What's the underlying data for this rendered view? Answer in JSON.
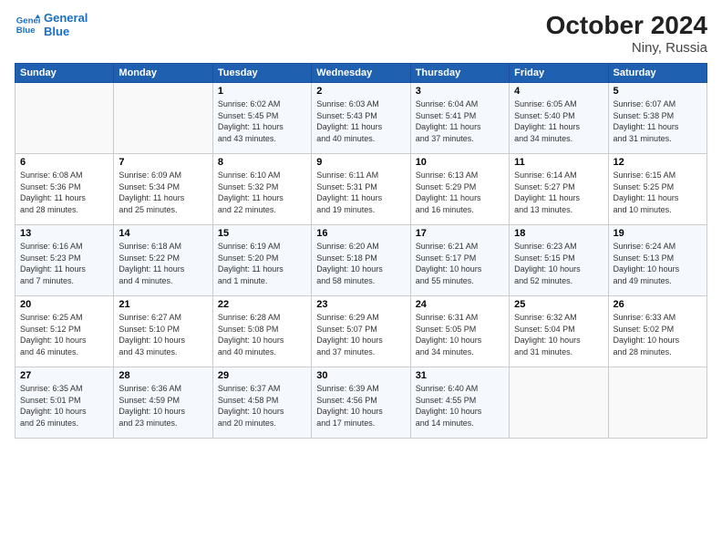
{
  "logo": {
    "line1": "General",
    "line2": "Blue"
  },
  "title": "October 2024",
  "subtitle": "Niny, Russia",
  "days_of_week": [
    "Sunday",
    "Monday",
    "Tuesday",
    "Wednesday",
    "Thursday",
    "Friday",
    "Saturday"
  ],
  "weeks": [
    [
      {
        "num": "",
        "info": ""
      },
      {
        "num": "",
        "info": ""
      },
      {
        "num": "1",
        "info": "Sunrise: 6:02 AM\nSunset: 5:45 PM\nDaylight: 11 hours\nand 43 minutes."
      },
      {
        "num": "2",
        "info": "Sunrise: 6:03 AM\nSunset: 5:43 PM\nDaylight: 11 hours\nand 40 minutes."
      },
      {
        "num": "3",
        "info": "Sunrise: 6:04 AM\nSunset: 5:41 PM\nDaylight: 11 hours\nand 37 minutes."
      },
      {
        "num": "4",
        "info": "Sunrise: 6:05 AM\nSunset: 5:40 PM\nDaylight: 11 hours\nand 34 minutes."
      },
      {
        "num": "5",
        "info": "Sunrise: 6:07 AM\nSunset: 5:38 PM\nDaylight: 11 hours\nand 31 minutes."
      }
    ],
    [
      {
        "num": "6",
        "info": "Sunrise: 6:08 AM\nSunset: 5:36 PM\nDaylight: 11 hours\nand 28 minutes."
      },
      {
        "num": "7",
        "info": "Sunrise: 6:09 AM\nSunset: 5:34 PM\nDaylight: 11 hours\nand 25 minutes."
      },
      {
        "num": "8",
        "info": "Sunrise: 6:10 AM\nSunset: 5:32 PM\nDaylight: 11 hours\nand 22 minutes."
      },
      {
        "num": "9",
        "info": "Sunrise: 6:11 AM\nSunset: 5:31 PM\nDaylight: 11 hours\nand 19 minutes."
      },
      {
        "num": "10",
        "info": "Sunrise: 6:13 AM\nSunset: 5:29 PM\nDaylight: 11 hours\nand 16 minutes."
      },
      {
        "num": "11",
        "info": "Sunrise: 6:14 AM\nSunset: 5:27 PM\nDaylight: 11 hours\nand 13 minutes."
      },
      {
        "num": "12",
        "info": "Sunrise: 6:15 AM\nSunset: 5:25 PM\nDaylight: 11 hours\nand 10 minutes."
      }
    ],
    [
      {
        "num": "13",
        "info": "Sunrise: 6:16 AM\nSunset: 5:23 PM\nDaylight: 11 hours\nand 7 minutes."
      },
      {
        "num": "14",
        "info": "Sunrise: 6:18 AM\nSunset: 5:22 PM\nDaylight: 11 hours\nand 4 minutes."
      },
      {
        "num": "15",
        "info": "Sunrise: 6:19 AM\nSunset: 5:20 PM\nDaylight: 11 hours\nand 1 minute."
      },
      {
        "num": "16",
        "info": "Sunrise: 6:20 AM\nSunset: 5:18 PM\nDaylight: 10 hours\nand 58 minutes."
      },
      {
        "num": "17",
        "info": "Sunrise: 6:21 AM\nSunset: 5:17 PM\nDaylight: 10 hours\nand 55 minutes."
      },
      {
        "num": "18",
        "info": "Sunrise: 6:23 AM\nSunset: 5:15 PM\nDaylight: 10 hours\nand 52 minutes."
      },
      {
        "num": "19",
        "info": "Sunrise: 6:24 AM\nSunset: 5:13 PM\nDaylight: 10 hours\nand 49 minutes."
      }
    ],
    [
      {
        "num": "20",
        "info": "Sunrise: 6:25 AM\nSunset: 5:12 PM\nDaylight: 10 hours\nand 46 minutes."
      },
      {
        "num": "21",
        "info": "Sunrise: 6:27 AM\nSunset: 5:10 PM\nDaylight: 10 hours\nand 43 minutes."
      },
      {
        "num": "22",
        "info": "Sunrise: 6:28 AM\nSunset: 5:08 PM\nDaylight: 10 hours\nand 40 minutes."
      },
      {
        "num": "23",
        "info": "Sunrise: 6:29 AM\nSunset: 5:07 PM\nDaylight: 10 hours\nand 37 minutes."
      },
      {
        "num": "24",
        "info": "Sunrise: 6:31 AM\nSunset: 5:05 PM\nDaylight: 10 hours\nand 34 minutes."
      },
      {
        "num": "25",
        "info": "Sunrise: 6:32 AM\nSunset: 5:04 PM\nDaylight: 10 hours\nand 31 minutes."
      },
      {
        "num": "26",
        "info": "Sunrise: 6:33 AM\nSunset: 5:02 PM\nDaylight: 10 hours\nand 28 minutes."
      }
    ],
    [
      {
        "num": "27",
        "info": "Sunrise: 6:35 AM\nSunset: 5:01 PM\nDaylight: 10 hours\nand 26 minutes."
      },
      {
        "num": "28",
        "info": "Sunrise: 6:36 AM\nSunset: 4:59 PM\nDaylight: 10 hours\nand 23 minutes."
      },
      {
        "num": "29",
        "info": "Sunrise: 6:37 AM\nSunset: 4:58 PM\nDaylight: 10 hours\nand 20 minutes."
      },
      {
        "num": "30",
        "info": "Sunrise: 6:39 AM\nSunset: 4:56 PM\nDaylight: 10 hours\nand 17 minutes."
      },
      {
        "num": "31",
        "info": "Sunrise: 6:40 AM\nSunset: 4:55 PM\nDaylight: 10 hours\nand 14 minutes."
      },
      {
        "num": "",
        "info": ""
      },
      {
        "num": "",
        "info": ""
      }
    ]
  ]
}
